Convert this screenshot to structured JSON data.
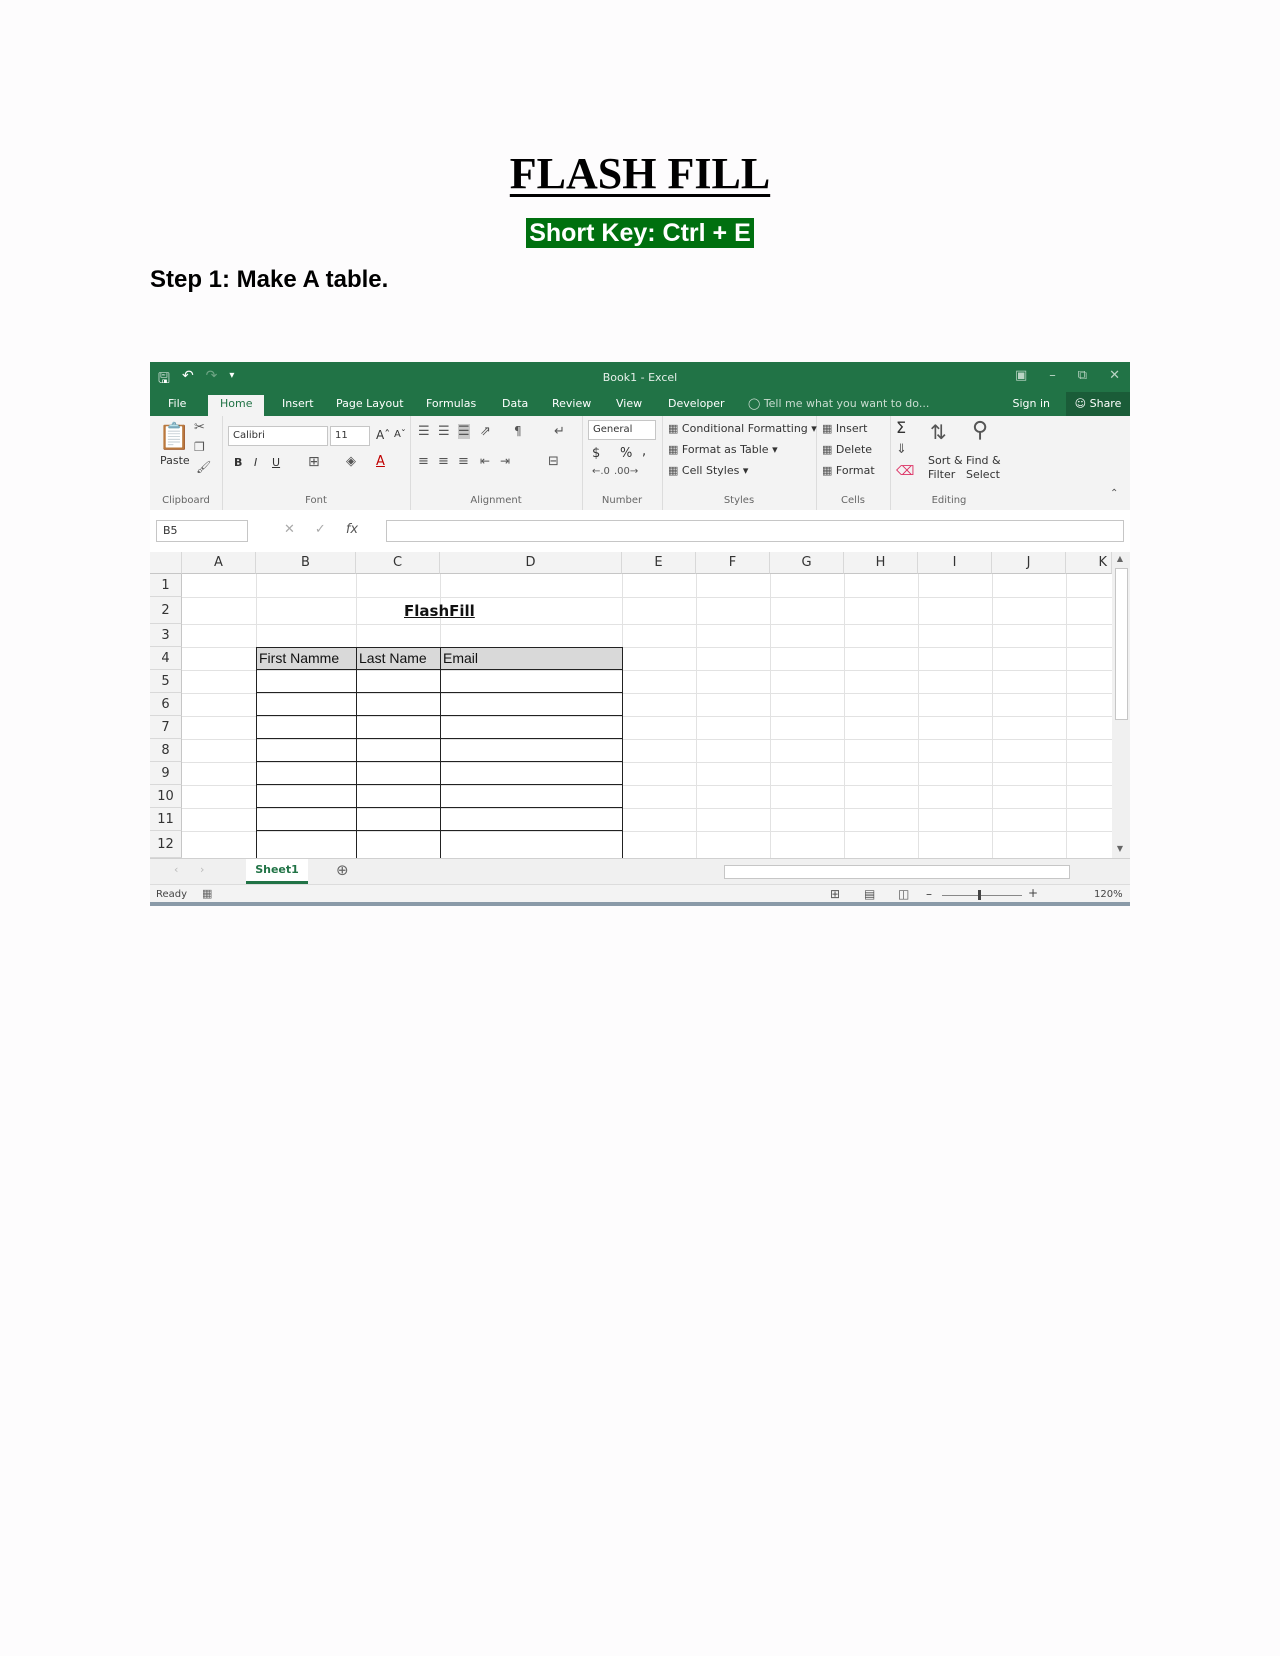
{
  "doc": {
    "title": "FLASH FILL",
    "shortkey": "Short Key: Ctrl + E",
    "step": "Step 1: Make A table."
  },
  "excel": {
    "window_title": "Book1 - Excel",
    "tabs": [
      "File",
      "Home",
      "Insert",
      "Page Layout",
      "Formulas",
      "Data",
      "Review",
      "View",
      "Developer"
    ],
    "tell_me": "Tell me what you want to do...",
    "sign_in": "Sign in",
    "share": "Share",
    "ribbon": {
      "paste": "Paste",
      "font_name": "Calibri",
      "font_size": "11",
      "bold": "B",
      "italic": "I",
      "underline": "U",
      "number_format": "General",
      "currency": "$",
      "percent": "%",
      "comma": ",",
      "conditional_formatting": "Conditional Formatting",
      "format_as_table": "Format as Table",
      "cell_styles": "Cell Styles",
      "insert": "Insert",
      "delete": "Delete",
      "format": "Format",
      "sort_filter_1": "Sort &",
      "sort_filter_2": "Filter",
      "find_select_1": "Find &",
      "find_select_2": "Select",
      "groups": [
        "Clipboard",
        "Font",
        "Alignment",
        "Number",
        "Styles",
        "Cells",
        "Editing"
      ]
    },
    "name_box": "B5",
    "fx": "fx",
    "columns": [
      "A",
      "B",
      "C",
      "D",
      "E",
      "F",
      "G",
      "H",
      "I",
      "J",
      "K"
    ],
    "rows": [
      "1",
      "2",
      "3",
      "4",
      "5",
      "6",
      "7",
      "8",
      "9",
      "10",
      "11",
      "12"
    ],
    "sheet_title": "FlashFill",
    "table_headers": [
      "First Namme",
      "Last Name",
      "Email"
    ],
    "sheet_tab": "Sheet1",
    "status": "Ready",
    "zoom": "120%"
  }
}
